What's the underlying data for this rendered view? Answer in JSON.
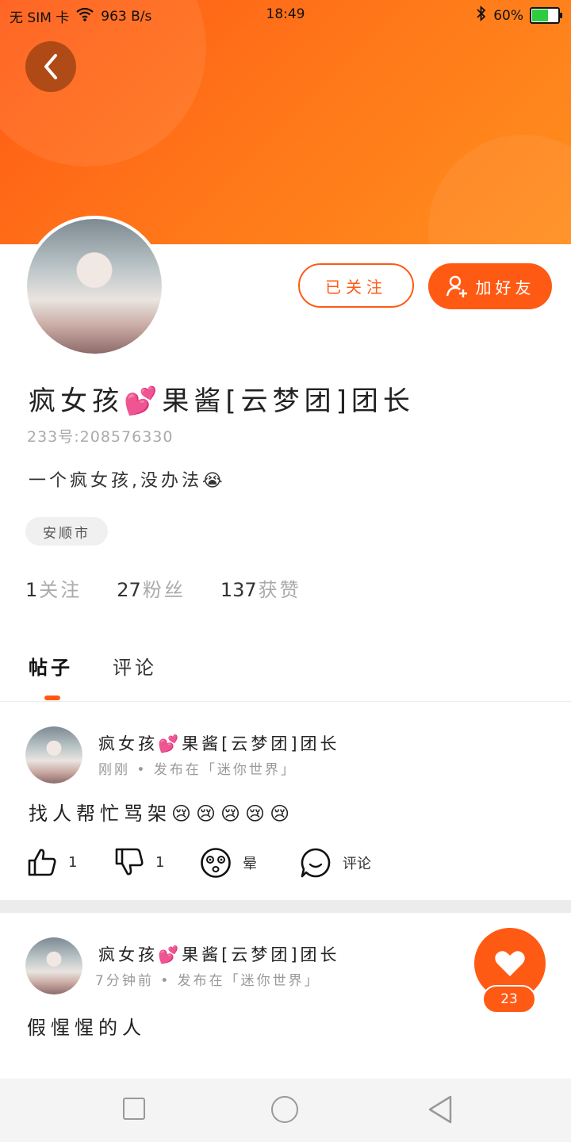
{
  "status": {
    "carrier": "无 SIM 卡",
    "speed": "963 B/s",
    "time": "18:49",
    "battery": "60%"
  },
  "profile": {
    "name": "疯女孩💕果酱[云梦团]团长",
    "uid": "233号:208576330",
    "bio": "一个疯女孩,没办法😭",
    "location": "安顺市",
    "buttons": {
      "followed": "已关注",
      "add_friend": "加好友"
    },
    "stats": [
      {
        "num": "1",
        "label": "关注"
      },
      {
        "num": "27",
        "label": "粉丝"
      },
      {
        "num": "137",
        "label": "获赞"
      }
    ]
  },
  "tabs": [
    {
      "label": "帖子"
    },
    {
      "label": "评论"
    }
  ],
  "posts": [
    {
      "author": "疯女孩💕果酱[云梦团]团长",
      "meta": "刚刚 • 发布在「迷你世界」",
      "text": "找人帮忙骂架😢😢😢😢😢",
      "actions": {
        "like": "1",
        "dislike": "1",
        "dizzy": "晕",
        "comment": "评论"
      }
    },
    {
      "author": "疯女孩💕果酱[云梦团]团长",
      "meta": "7分钟前 • 发布在「迷你世界」",
      "text": "假惺惺的人"
    }
  ],
  "fab": {
    "count": "23"
  },
  "colors": {
    "accent": "#ff5a14"
  }
}
